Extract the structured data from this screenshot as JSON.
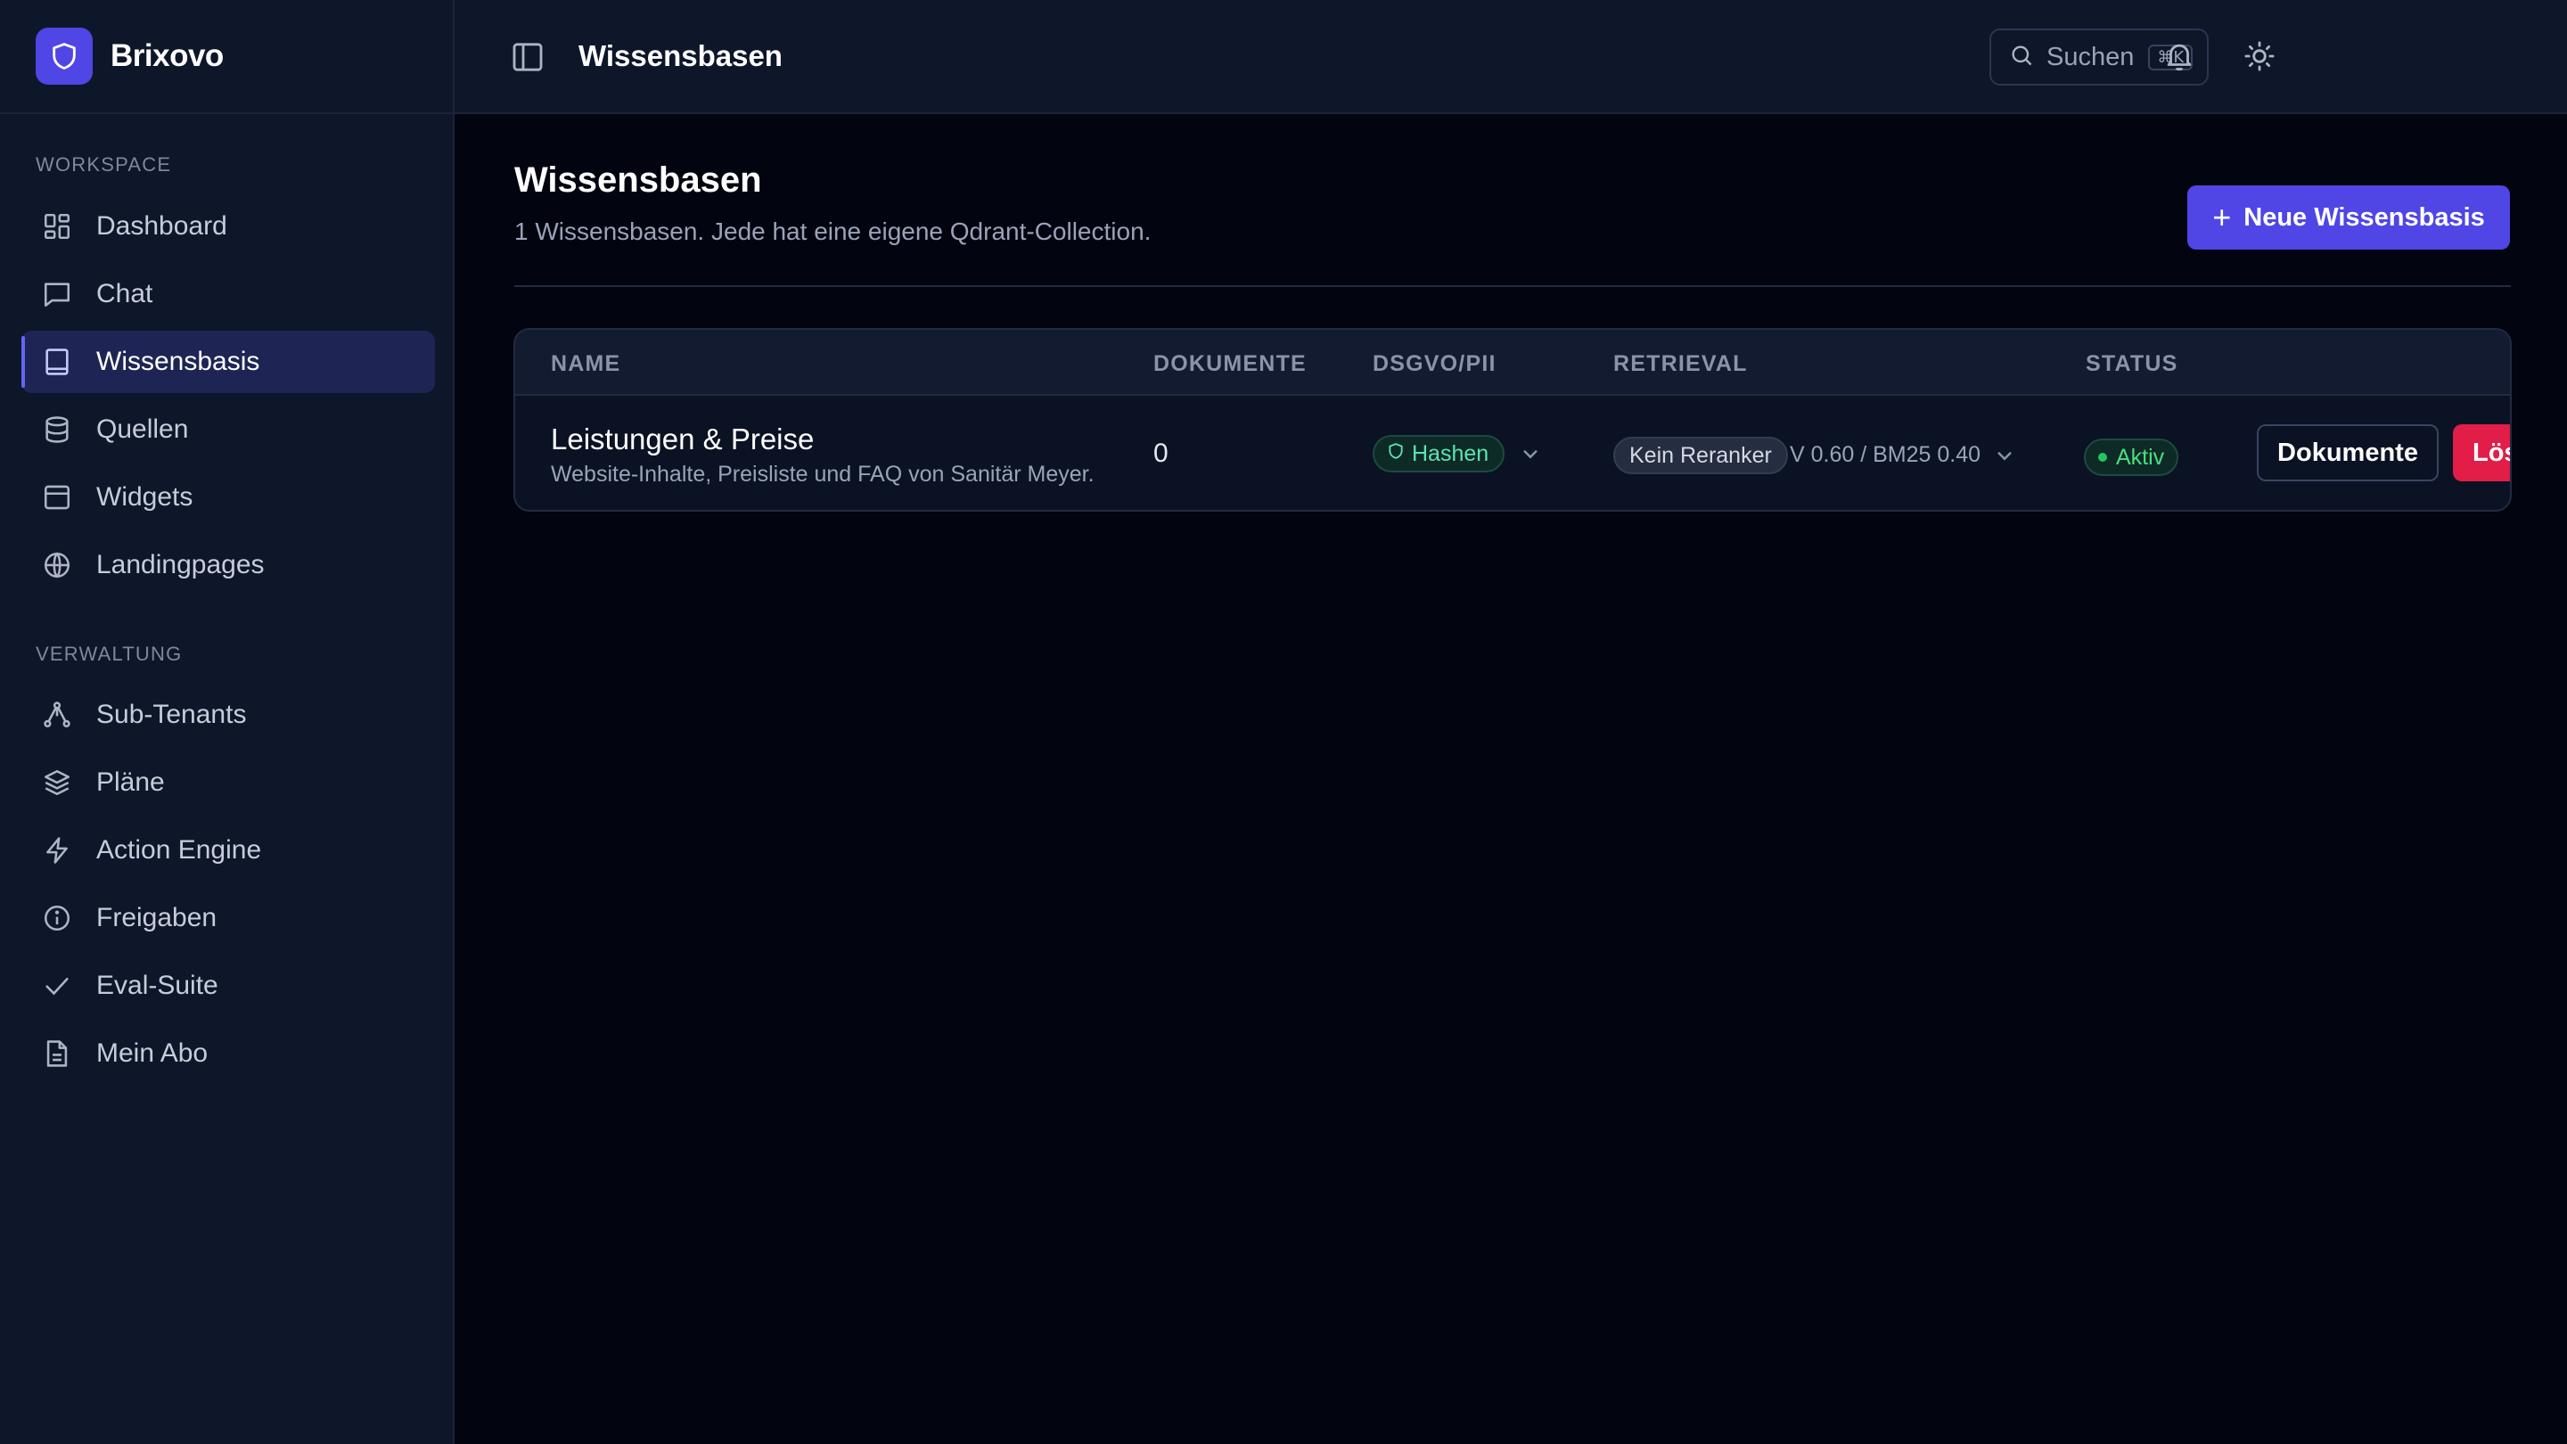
{
  "brand": {
    "name": "Brixovo"
  },
  "header": {
    "title": "Wissensbasen",
    "search_label": "Suchen",
    "search_shortcut": "⌘K"
  },
  "sidebar": {
    "sections": [
      {
        "label": "WORKSPACE",
        "items": [
          {
            "label": "Dashboard",
            "icon": "dashboard-icon"
          },
          {
            "label": "Chat",
            "icon": "chat-icon"
          },
          {
            "label": "Wissensbasis",
            "icon": "book-icon",
            "active": true
          },
          {
            "label": "Quellen",
            "icon": "database-icon"
          },
          {
            "label": "Widgets",
            "icon": "widget-icon"
          },
          {
            "label": "Landingpages",
            "icon": "globe-icon"
          }
        ]
      },
      {
        "label": "VERWALTUNG",
        "items": [
          {
            "label": "Sub-Tenants",
            "icon": "network-icon"
          },
          {
            "label": "Pläne",
            "icon": "layers-icon"
          },
          {
            "label": "Action Engine",
            "icon": "bolt-icon"
          },
          {
            "label": "Freigaben",
            "icon": "info-icon"
          },
          {
            "label": "Eval-Suite",
            "icon": "check-icon"
          },
          {
            "label": "Mein Abo",
            "icon": "document-icon"
          }
        ]
      }
    ]
  },
  "main": {
    "title": "Wissensbasen",
    "subtitle": "1 Wissensbasen. Jede hat eine eigene Qdrant-Collection.",
    "new_button_label": "Neue Wissensbasis",
    "table": {
      "columns": [
        "NAME",
        "DOKUMENTE",
        "DSGVO/PII",
        "RETRIEVAL",
        "STATUS"
      ],
      "rows": [
        {
          "name": "Leistungen & Preise",
          "description": "Website-Inhalte, Preisliste und FAQ von Sanitär Meyer.",
          "documents": "0",
          "pii_mode": "Hashen",
          "reranker": "Kein Reranker",
          "retrieval_params": "V 0.60 / BM25 0.40",
          "status": "Aktiv",
          "docs_button": "Dokumente",
          "delete_button": "Lös"
        }
      ]
    }
  },
  "colors": {
    "accent": "#4f46e5",
    "danger": "#e11d48",
    "success": "#22c55e",
    "sidebar_bg": "#0e162a",
    "page_bg": "#02040f"
  }
}
